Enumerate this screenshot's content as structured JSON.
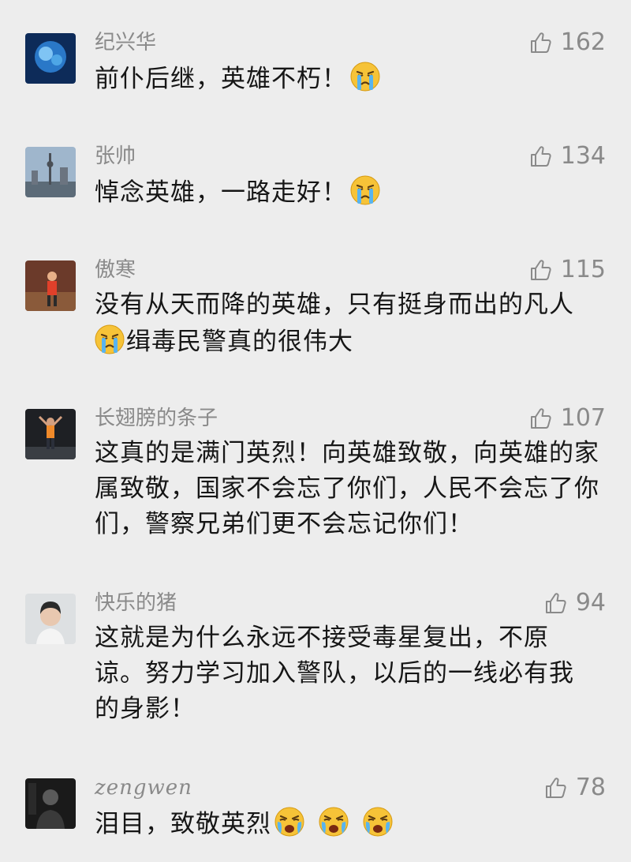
{
  "comments": [
    {
      "username": "纪兴华",
      "likes": "162",
      "text": "前仆后继，英雄不朽！"
    },
    {
      "username": "张帅",
      "likes": "134",
      "text": "悼念英雄，一路走好！"
    },
    {
      "username": "傲寒",
      "likes": "115",
      "text_line1": "没有从天而降的英雄，只有挺身而出的凡人",
      "text_line2": "缉毒民警真的很伟大"
    },
    {
      "username": "长翅膀的条子",
      "likes": "107",
      "text": "这真的是满门英烈！向英雄致敬，向英雄的家属致敬，国家不会忘了你们，人民不会忘了你们，警察兄弟们更不会忘记你们！"
    },
    {
      "username": "快乐的猪",
      "likes": "94",
      "text": "这就是为什么永远不接受毒星复出，不原谅。努力学习加入警队，以后的一线必有我的身影！"
    },
    {
      "username": "zengwen",
      "likes": "78",
      "text": "泪目，致敬英烈"
    }
  ],
  "icons": {
    "like": "thumbs-up-icon",
    "emoji_cry": "crying-face-emoji",
    "emoji_sob": "loudly-crying-face-emoji"
  },
  "colors": {
    "background": "#ededed",
    "username": "#8a8a8a",
    "text": "#161616"
  }
}
